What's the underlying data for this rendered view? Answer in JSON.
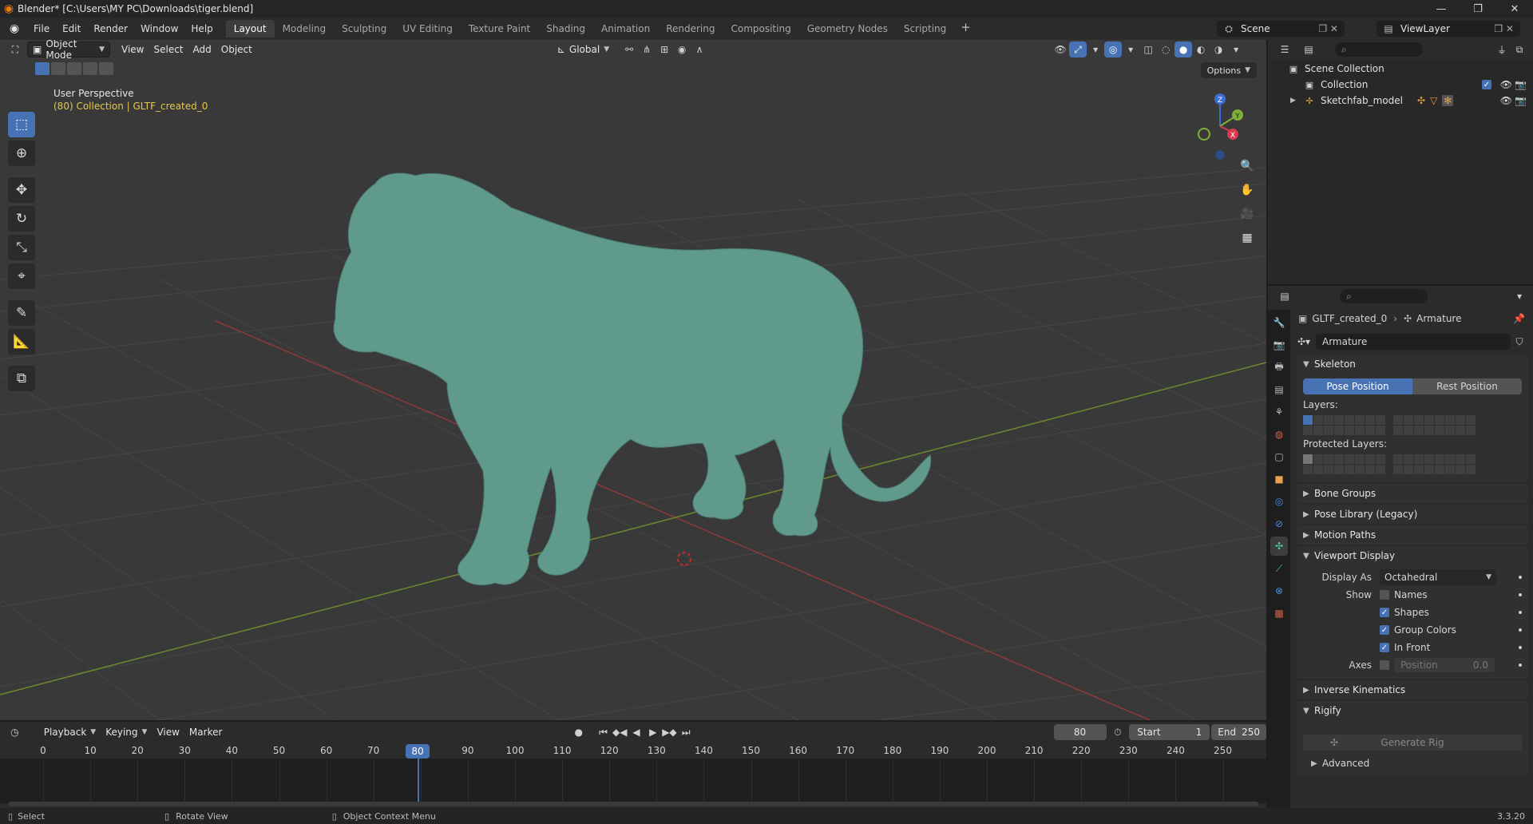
{
  "titlebar": {
    "title": "Blender* [C:\\Users\\MY PC\\Downloads\\tiger.blend]"
  },
  "menu": {
    "file": "File",
    "edit": "Edit",
    "render": "Render",
    "window": "Window",
    "help": "Help"
  },
  "workspaces": [
    "Layout",
    "Modeling",
    "Sculpting",
    "UV Editing",
    "Texture Paint",
    "Shading",
    "Animation",
    "Rendering",
    "Compositing",
    "Geometry Nodes",
    "Scripting"
  ],
  "scene": {
    "name": "Scene",
    "view_layer": "ViewLayer"
  },
  "viewport": {
    "mode": "Object Mode",
    "menus": {
      "view": "View",
      "select": "Select",
      "add": "Add",
      "object": "Object"
    },
    "transform_orientation": "Global",
    "options": "Options",
    "view_name": "User Perspective",
    "collection_info": "(80) Collection | GLTF_created_0",
    "accent": "#4772b3",
    "model_color": "#5f9a8c"
  },
  "timeline": {
    "menus": {
      "playback": "Playback",
      "keying": "Keying",
      "view": "View",
      "marker": "Marker"
    },
    "current_frame": "80",
    "start_label": "Start",
    "start": "1",
    "end_label": "End",
    "end": "250",
    "ticks": [
      "0",
      "10",
      "20",
      "30",
      "40",
      "50",
      "60",
      "70",
      "80",
      "90",
      "100",
      "110",
      "120",
      "130",
      "140",
      "150",
      "160",
      "170",
      "180",
      "190",
      "200",
      "210",
      "220",
      "230",
      "240",
      "250"
    ]
  },
  "status": {
    "select": "Select",
    "rotate": "Rotate View",
    "context": "Object Context Menu",
    "version": "3.3.20"
  },
  "outliner": {
    "scene_collection": "Scene Collection",
    "collection": "Collection",
    "model": "Sketchfab_model"
  },
  "properties": {
    "breadcrumb_object": "GLTF_created_0",
    "breadcrumb_data": "Armature",
    "data_name": "Armature",
    "skeleton": {
      "title": "Skeleton",
      "pose_position": "Pose Position",
      "rest_position": "Rest Position",
      "layers": "Layers:",
      "protected_layers": "Protected Layers:"
    },
    "bone_groups": "Bone Groups",
    "pose_library": "Pose Library (Legacy)",
    "motion_paths": "Motion Paths",
    "viewport_display": {
      "title": "Viewport Display",
      "display_as_label": "Display As",
      "display_as": "Octahedral",
      "show_label": "Show",
      "names": "Names",
      "shapes": "Shapes",
      "group_colors": "Group Colors",
      "in_front": "In Front",
      "axes_label": "Axes",
      "position_label": "Position",
      "position_value": "0.0"
    },
    "inverse_kinematics": "Inverse Kinematics",
    "rigify": "Rigify",
    "generate_rig": "Generate Rig",
    "advanced": "Advanced"
  }
}
